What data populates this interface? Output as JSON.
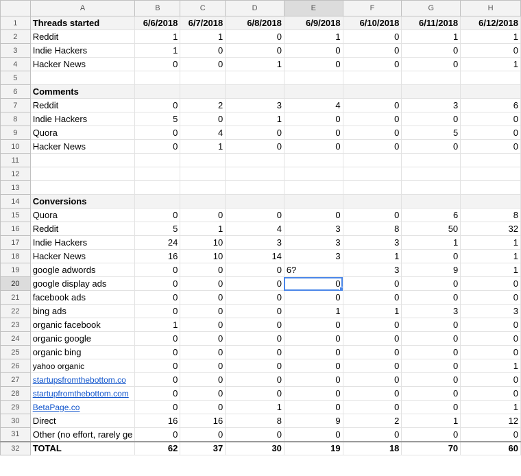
{
  "columns": [
    "A",
    "B",
    "C",
    "D",
    "E",
    "F",
    "G",
    "H"
  ],
  "selected": {
    "row": 20,
    "col": "E"
  },
  "rows": [
    {
      "n": "1",
      "style": "gray bold",
      "label": "Threads started",
      "vals": [
        "6/6/2018",
        "6/7/2018",
        "6/8/2018",
        "6/9/2018",
        "6/10/2018",
        "6/11/2018",
        "6/12/2018"
      ]
    },
    {
      "n": "2",
      "label": "Reddit",
      "vals": [
        "1",
        "1",
        "0",
        "1",
        "0",
        "1",
        "1"
      ]
    },
    {
      "n": "3",
      "label": "Indie Hackers",
      "vals": [
        "1",
        "0",
        "0",
        "0",
        "0",
        "0",
        "0"
      ]
    },
    {
      "n": "4",
      "label": "Hacker News",
      "vals": [
        "0",
        "0",
        "1",
        "0",
        "0",
        "0",
        "1"
      ]
    },
    {
      "n": "5",
      "label": "",
      "vals": [
        "",
        "",
        "",
        "",
        "",
        "",
        ""
      ]
    },
    {
      "n": "6",
      "style": "gray bold",
      "label": "Comments",
      "vals": [
        "",
        "",
        "",
        "",
        "",
        "",
        ""
      ]
    },
    {
      "n": "7",
      "label": "Reddit",
      "vals": [
        "0",
        "2",
        "3",
        "4",
        "0",
        "3",
        "6"
      ]
    },
    {
      "n": "8",
      "label": "Indie Hackers",
      "vals": [
        "5",
        "0",
        "1",
        "0",
        "0",
        "0",
        "0"
      ]
    },
    {
      "n": "9",
      "label": "Quora",
      "vals": [
        "0",
        "4",
        "0",
        "0",
        "0",
        "5",
        "0"
      ]
    },
    {
      "n": "10",
      "label": "Hacker News",
      "vals": [
        "0",
        "1",
        "0",
        "0",
        "0",
        "0",
        "0"
      ]
    },
    {
      "n": "11",
      "label": "",
      "vals": [
        "",
        "",
        "",
        "",
        "",
        "",
        ""
      ]
    },
    {
      "n": "12",
      "label": "",
      "vals": [
        "",
        "",
        "",
        "",
        "",
        "",
        ""
      ]
    },
    {
      "n": "13",
      "label": "",
      "vals": [
        "",
        "",
        "",
        "",
        "",
        "",
        ""
      ]
    },
    {
      "n": "14",
      "style": "gray bold",
      "label": "Conversions",
      "vals": [
        "",
        "",
        "",
        "",
        "",
        "",
        ""
      ]
    },
    {
      "n": "15",
      "label": "Quora",
      "vals": [
        "0",
        "0",
        "0",
        "0",
        "0",
        "6",
        "8"
      ]
    },
    {
      "n": "16",
      "label": "Reddit",
      "vals": [
        "5",
        "1",
        "4",
        "3",
        "8",
        "50",
        "32"
      ]
    },
    {
      "n": "17",
      "label": "Indie Hackers",
      "vals": [
        "24",
        "10",
        "3",
        "3",
        "3",
        "1",
        "1"
      ]
    },
    {
      "n": "18",
      "label": "Hacker News",
      "vals": [
        "16",
        "10",
        "14",
        "3",
        "1",
        "0",
        "1"
      ]
    },
    {
      "n": "19",
      "label": "google adwords",
      "vals": [
        "0",
        "0",
        "0",
        "6?",
        "3",
        "9",
        "1"
      ],
      "leftE": true
    },
    {
      "n": "20",
      "label": "google display ads",
      "vals": [
        "0",
        "0",
        "0",
        "0",
        "0",
        "0",
        "0"
      ]
    },
    {
      "n": "21",
      "label": "facebook ads",
      "vals": [
        "0",
        "0",
        "0",
        "0",
        "0",
        "0",
        "0"
      ]
    },
    {
      "n": "22",
      "label": "bing ads",
      "vals": [
        "0",
        "0",
        "0",
        "1",
        "1",
        "3",
        "3"
      ]
    },
    {
      "n": "23",
      "label": "organic facebook",
      "vals": [
        "1",
        "0",
        "0",
        "0",
        "0",
        "0",
        "0"
      ]
    },
    {
      "n": "24",
      "label": "organic google",
      "vals": [
        "0",
        "0",
        "0",
        "0",
        "0",
        "0",
        "0"
      ]
    },
    {
      "n": "25",
      "label": "organic bing",
      "vals": [
        "0",
        "0",
        "0",
        "0",
        "0",
        "0",
        "0"
      ]
    },
    {
      "n": "26",
      "label": "yahoo organic",
      "vals": [
        "0",
        "0",
        "0",
        "0",
        "0",
        "0",
        "1"
      ],
      "small": true
    },
    {
      "n": "27",
      "label": "startupsfromthebottom.co",
      "vals": [
        "0",
        "0",
        "0",
        "0",
        "0",
        "0",
        "0"
      ],
      "link": true
    },
    {
      "n": "28",
      "label": "startupfromthebottom.com",
      "vals": [
        "0",
        "0",
        "0",
        "0",
        "0",
        "0",
        "0"
      ],
      "link": true
    },
    {
      "n": "29",
      "label": "BetaPage.co",
      "vals": [
        "0",
        "0",
        "1",
        "0",
        "0",
        "0",
        "1"
      ],
      "link": true
    },
    {
      "n": "30",
      "label": "Direct",
      "vals": [
        "16",
        "16",
        "8",
        "9",
        "2",
        "1",
        "12"
      ]
    },
    {
      "n": "31",
      "label": "Other (no effort, rarely ge",
      "vals": [
        "0",
        "0",
        "0",
        "0",
        "0",
        "0",
        "0"
      ]
    },
    {
      "n": "32",
      "style": "bold total",
      "label": "TOTAL",
      "vals": [
        "62",
        "37",
        "30",
        "19",
        "18",
        "70",
        "60"
      ]
    }
  ]
}
